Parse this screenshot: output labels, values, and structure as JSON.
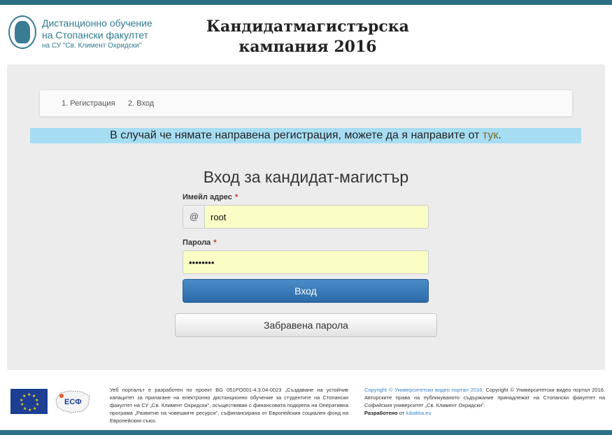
{
  "header": {
    "logo_line1": "Дистанционно обучение",
    "logo_line2": "на Стопански факултет",
    "logo_line3": "на СУ \"Св. Климент Охридски\"",
    "title_line1": "Кандидатмагистърска",
    "title_line2": "кампания 2016"
  },
  "steps": [
    {
      "label": "1. Регистрация"
    },
    {
      "label": "2. Вход"
    }
  ],
  "notice": {
    "text": "В случай че нямате направена регистрация, можете да я направите от ",
    "link": "тук",
    "end": "."
  },
  "form": {
    "title": "Вход за кандидат-магистър",
    "email_label": "Имейл адрес",
    "email_prefix": "@",
    "email_value": "root",
    "password_label": "Парола",
    "password_value": "rootroot",
    "required_mark": "*",
    "login_button": "Вход",
    "forgot_button": "Забравена парола"
  },
  "footer": {
    "left_text": "Уеб порталът е разработен по проект BG 051PO001-4.3.04-0023 „Създаване на устойчив капацитет за прилагане на електронно дистанционно обучение за студентите на Стопански факултет на СУ „Св. Климент Охридски\", осъществяван с финансовата подкрепа на Оперативна програма „Развитие на човешките ресурси\", съфинансирана от Европейския социален фонд на Европейския съюз.",
    "copyright_link": "Copyright © Университетски видео портал 2016",
    "copyright_text": ". Copyright © Университетски видео портал 2016. Авторските права на публикуваното съдържание принадлежат на Стопански факултет на Софийския университет „Св. Климент Охридски\".",
    "developed_label": "Разработено",
    "developed_by": " от ",
    "developer_link": "lubakka.eu",
    "esf_logo_text": "ЕСФ"
  },
  "colors": {
    "brand_bar": "#2a7186",
    "notice_bg": "#a6ddf3",
    "primary_button": "#2c6aa8",
    "input_autofill": "#fafdc4"
  },
  "icons": {
    "seal": "university-seal-icon",
    "eu_flag": "eu-flag-icon",
    "esf": "esf-logo-icon"
  }
}
